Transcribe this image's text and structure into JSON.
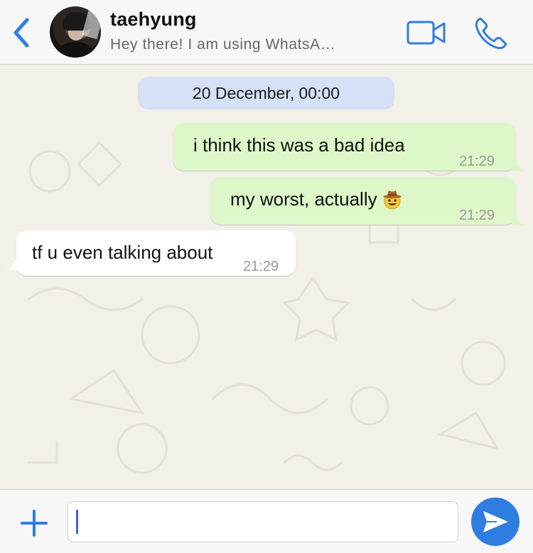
{
  "header": {
    "contact_name": "taehyung",
    "contact_status": "Hey there! I am using WhatsA…",
    "back_icon": "chevron-left-icon",
    "video_icon": "video-camera-icon",
    "call_icon": "phone-icon",
    "accent": "#2f7de1"
  },
  "chat": {
    "date_label": "20 December, 00:00",
    "messages": [
      {
        "direction": "outgoing",
        "text": "i think this was a bad idea",
        "time": "21:29"
      },
      {
        "direction": "outgoing",
        "text": "my worst, actually",
        "emoji": "cowboy-hat-face",
        "time": "21:29"
      },
      {
        "direction": "incoming",
        "text": "tf u even talking about",
        "time": "21:29"
      }
    ],
    "outgoing_color": "#ddf7c8",
    "incoming_color": "#ffffff"
  },
  "composer": {
    "value": "",
    "attach_icon": "plus-icon",
    "send_icon": "send-icon"
  }
}
